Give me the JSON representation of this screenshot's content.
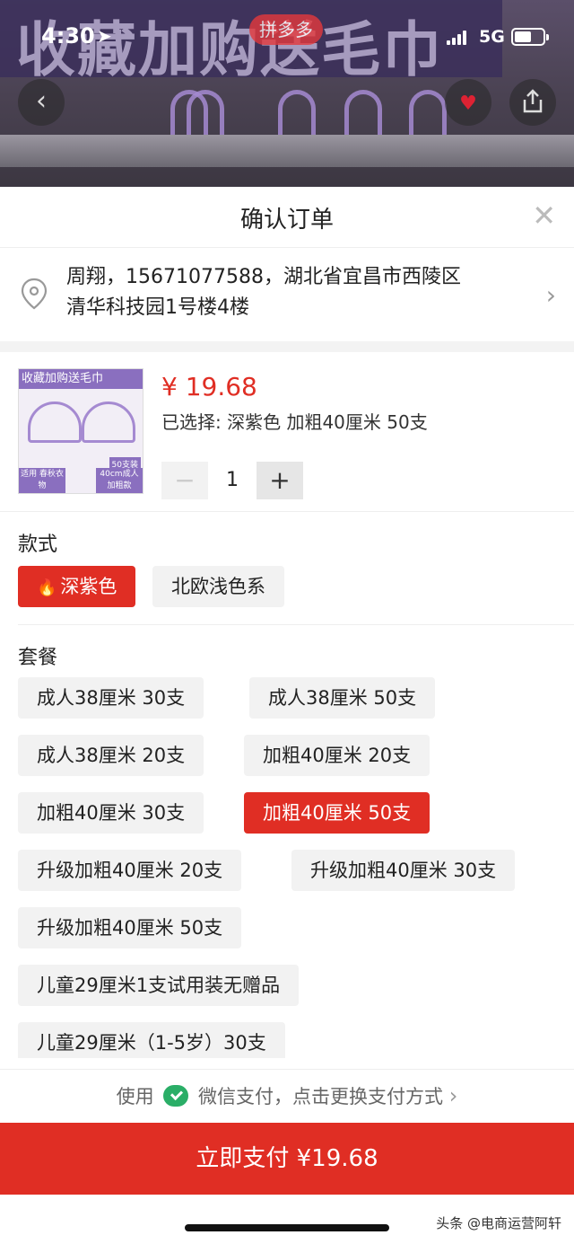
{
  "background": {
    "banner_text": "收藏加购送毛巾",
    "badge": "拼多多"
  },
  "status_bar": {
    "time": "4:30",
    "network": "5G"
  },
  "sheet": {
    "title": "确认订单",
    "close_symbol": "✕"
  },
  "address": {
    "line1": "周翔，15671077588，湖北省宜昌市西陵区",
    "line2": "清华科技园1号楼4楼"
  },
  "product": {
    "thumb_banner": "收藏加购送毛巾",
    "thumb_tag": "50支装",
    "thumb_left": "适用 春秋衣物",
    "thumb_right": "40cm成人 加粗款",
    "price": "¥ 19.68",
    "selected": "已选择: 深紫色 加粗40厘米   50支",
    "quantity": "1",
    "minus": "−",
    "plus": "+"
  },
  "style_section": {
    "title": "款式",
    "options": [
      {
        "label": "深紫色",
        "active": true
      },
      {
        "label": "北欧浅色系",
        "active": false
      }
    ]
  },
  "package_section": {
    "title": "套餐",
    "options": [
      {
        "label": "成人38厘米   30支",
        "active": false
      },
      {
        "label": "成人38厘米   50支",
        "active": false
      },
      {
        "label": "成人38厘米  20支",
        "active": false
      },
      {
        "label": "加粗40厘米   20支",
        "active": false
      },
      {
        "label": "加粗40厘米  30支",
        "active": false
      },
      {
        "label": "加粗40厘米   50支",
        "active": true
      },
      {
        "label": "升级加粗40厘米   20支",
        "active": false
      },
      {
        "label": "升级加粗40厘米   30支",
        "active": false
      },
      {
        "label": "升级加粗40厘米   50支",
        "active": false
      },
      {
        "label": "儿童29厘米1支试用装无赠品",
        "active": false
      },
      {
        "label": "儿童29厘米（1-5岁）30支",
        "active": false
      }
    ]
  },
  "payment": {
    "prefix": "使用",
    "method": "微信支付，点击更换支付方式",
    "button": "立即支付 ¥19.68"
  },
  "watermark": "头条 @电商运营阿轩",
  "colors": {
    "accent": "#e02e24",
    "wechat": "#2aae67"
  }
}
